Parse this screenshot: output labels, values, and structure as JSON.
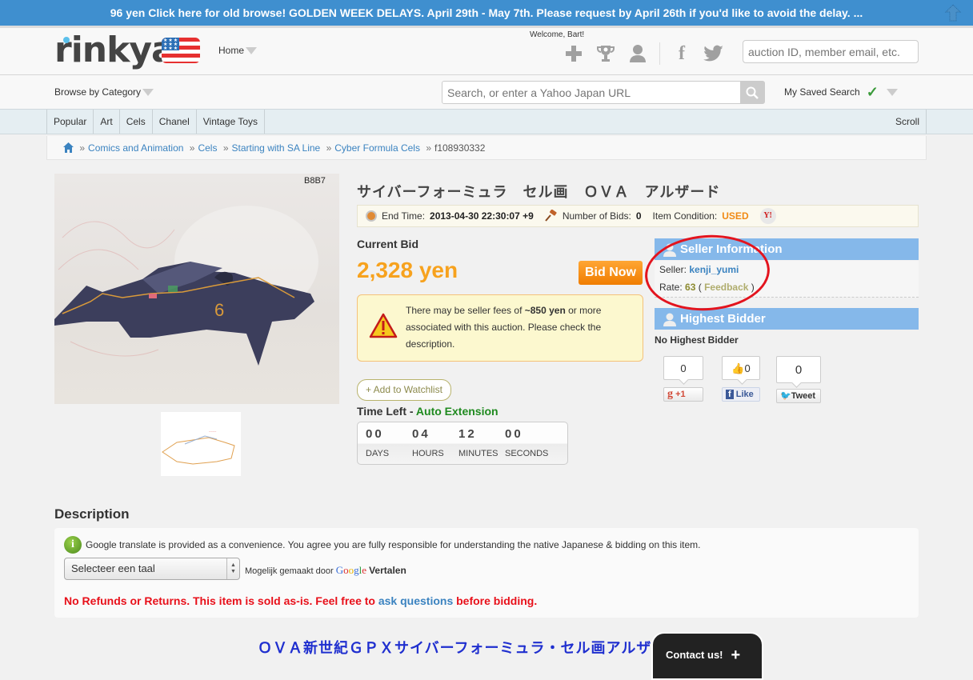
{
  "banner": {
    "text": "96 yen Click here for old browse! GOLDEN WEEK DELAYS. April 29th - May 7th. Please request by April 26th if you'd like to avoid the delay. ..."
  },
  "header": {
    "logo": "rinkya",
    "home_label": "Home",
    "welcome": "Welcome, Bart!",
    "icons": [
      "plus-icon",
      "trophy-icon",
      "user-icon",
      "facebook-icon",
      "twitter-icon"
    ],
    "member_search_placeholder": "auction ID, member email, etc."
  },
  "catbar": {
    "browse_label": "Browse by Category",
    "search_placeholder": "Search, or enter a Yahoo Japan URL",
    "saved_search_label": "My Saved Search"
  },
  "tabs": {
    "items": [
      "Popular",
      "Art",
      "Cels",
      "Chanel",
      "Vintage Toys"
    ],
    "scroll_label": "Scroll"
  },
  "breadcrumb": {
    "items": [
      "Comics and Animation",
      "Cels",
      "Starting with SA Line",
      "Cyber Formula Cels"
    ],
    "current": "f108930332",
    "separator": "»"
  },
  "item": {
    "title": "サイバーフォーミュラ　セル画　ＯＶＡ　アルザード",
    "end_time_label": "End Time:",
    "end_time": "2013-04-30 22:30:07 +9",
    "bids_label": "Number of Bids:",
    "bids": "0",
    "condition_label": "Item Condition:",
    "condition": "USED",
    "yahoo_icon_text": "Y!"
  },
  "bid": {
    "current_label": "Current Bid",
    "price": "2,328 yen",
    "bid_now_label": "Bid Now",
    "fee_pre": "There may be seller fees of ",
    "fee_amount": "~850 yen",
    "fee_post": " or more associated with this auction. Please check the description.",
    "watchlist_label": "+ Add to Watchlist",
    "time_left_label": "Time Left - ",
    "auto_extension": "Auto Extension",
    "countdown": [
      {
        "value": "00",
        "label": "DAYS"
      },
      {
        "value": "04",
        "label": "HOURS"
      },
      {
        "value": "12",
        "label": "MINUTES"
      },
      {
        "value": "00",
        "label": "SECONDS"
      }
    ]
  },
  "seller": {
    "heading": "Seller Information",
    "seller_label": "Seller:",
    "seller_name": "kenji_yumi",
    "rate_label": "Rate:",
    "rate": "63",
    "feedback_label": "Feedback"
  },
  "bidder": {
    "heading": "Highest Bidder",
    "status": "No Highest Bidder"
  },
  "social": {
    "gplus_count": "0",
    "gplus_label": "+1",
    "fb_count": "0",
    "fb_label": "Like",
    "tweet_count": "0",
    "tweet_label": "Tweet"
  },
  "description": {
    "heading": "Description",
    "translate_note": "Google translate is provided as a convenience. You agree you are fully responsible for understanding the native Japanese & bidding on this item.",
    "language_select": "Selecteer een taal",
    "powered_pre": "Mogelijk gemaakt door",
    "powered_google": "Google",
    "powered_post": "Vertalen",
    "refund_pre": "No Refunds or Returns. This item is sold as-is. Feel free to ",
    "ask_link": "ask questions",
    "refund_post": " before bidding.",
    "jp_title": "ＯＶＡ新世紀ＧＰＸサイバーフォーミュラ・セル画アルザード"
  },
  "contact": {
    "label": "Contact us!"
  },
  "colors": {
    "banner": "#3f8fcf",
    "price": "#f7a21e",
    "bid_button": "#f58a10",
    "panel_header": "#85b8ea",
    "link": "#3b83c0",
    "refund_warning": "#e8101a",
    "annotation_oval": "#e3141e"
  }
}
